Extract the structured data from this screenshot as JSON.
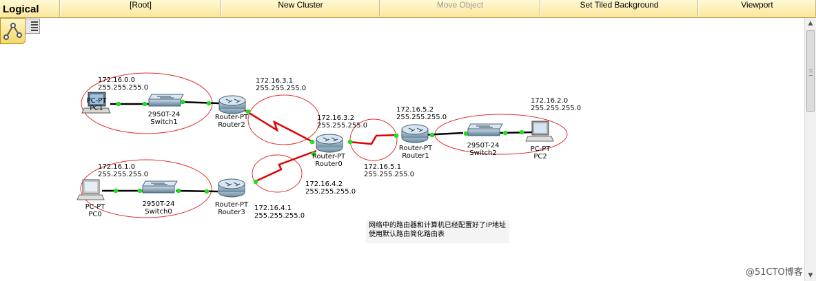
{
  "toolbar": {
    "title": "Logical",
    "root": "[Root]",
    "new_cluster": "New Cluster",
    "move_object": "Move Object",
    "set_tiled_background": "Set Tiled Background",
    "viewport": "Viewport"
  },
  "devices": {
    "pc1": {
      "type": "PC-PT",
      "name": "PC1"
    },
    "pc0": {
      "type": "PC-PT",
      "name": "PC0"
    },
    "pc2": {
      "type": "PC-PT",
      "name": "PC2"
    },
    "switch1": {
      "type": "2950T-24",
      "name": "Switch1"
    },
    "switch0": {
      "type": "2950T-24",
      "name": "Switch0"
    },
    "switch2": {
      "type": "2950T-24",
      "name": "Switch2"
    },
    "router0": {
      "type": "Router-PT",
      "name": "Router0"
    },
    "router1": {
      "type": "Router-PT",
      "name": "Router1"
    },
    "router2": {
      "type": "Router-PT",
      "name": "Router2"
    },
    "router3": {
      "type": "Router-PT",
      "name": "Router3"
    }
  },
  "notes": {
    "net_pc1": {
      "ip": "172.16.0.0",
      "mask": "255.255.255.0"
    },
    "net_pc0": {
      "ip": "172.16.1.0",
      "mask": "255.255.255.0"
    },
    "net_pc2": {
      "ip": "172.16.2.0",
      "mask": "255.255.255.0"
    },
    "r2_serial": {
      "ip": "172.16.3.1",
      "mask": "255.255.255.0"
    },
    "r0_serial_a": {
      "ip": "172.16.3.2",
      "mask": "255.255.255.0"
    },
    "r1_serial": {
      "ip": "172.16.5.2",
      "mask": "255.255.255.0"
    },
    "r0_serial_b": {
      "ip": "172.16.5.1",
      "mask": "255.255.255.0"
    },
    "r0_serial_c": {
      "ip": "172.16.4.2",
      "mask": "255.255.255.0"
    },
    "r3_serial": {
      "ip": "172.16.4.1",
      "mask": "255.255.255.0"
    },
    "chinese_note_line1": "网络中的路由器和计算机已经配置好了IP地址",
    "chinese_note_line2": "使用默认路由简化路由表"
  },
  "watermark": "@51CTO博客",
  "colors": {
    "toolbar_bg": "#fbe79b",
    "serial_link": "#e00000",
    "ethernet_link": "#000000",
    "port_up": "#22dd22",
    "ellipse": "#e03030"
  },
  "icons": {
    "logical": "logical-topology-icon",
    "grid": "grid-icon"
  }
}
